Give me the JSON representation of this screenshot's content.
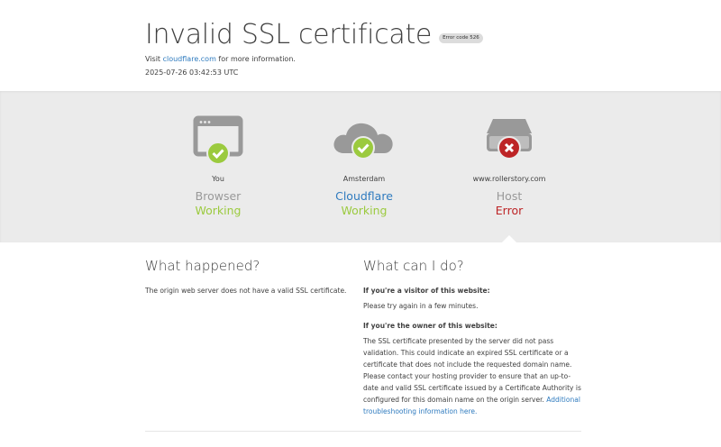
{
  "header": {
    "title": "Invalid SSL certificate",
    "error_badge": "Error code 526",
    "visit_prefix": "Visit ",
    "visit_link": "cloudflare.com",
    "visit_suffix": " for more information.",
    "timestamp": "2025-07-26 03:42:53 UTC"
  },
  "nodes": [
    {
      "icon": "browser-icon",
      "location": "You",
      "name": "Browser",
      "status": "Working",
      "status_type": "ok"
    },
    {
      "icon": "cloud-icon",
      "location": "Amsterdam",
      "name": "Cloudflare",
      "status": "Working",
      "status_type": "ok"
    },
    {
      "icon": "server-icon",
      "location": "www.rollerstory.com",
      "name": "Host",
      "status": "Error",
      "status_type": "error"
    }
  ],
  "what_happened": {
    "heading": "What happened?",
    "text": "The origin web server does not have a valid SSL certificate."
  },
  "what_can_i_do": {
    "heading": "What can I do?",
    "visitor_heading": "If you're a visitor of this website:",
    "visitor_text": "Please try again in a few minutes.",
    "owner_heading": "If you're the owner of this website:",
    "owner_text": "The SSL certificate presented by the server did not pass validation. This could indicate an expired SSL certificate or a certificate that does not include the requested domain name. Please contact your hosting provider to ensure that an up-to-date and valid SSL certificate issued by a Certificate Authority is configured for this domain name on the origin server. ",
    "owner_link": "Additional troubleshooting information here."
  },
  "colors": {
    "ok": "#9bca3e",
    "error": "#bd2426",
    "link": "#2f7bbf",
    "icon_gray": "#999999",
    "band": "#ebebeb"
  }
}
